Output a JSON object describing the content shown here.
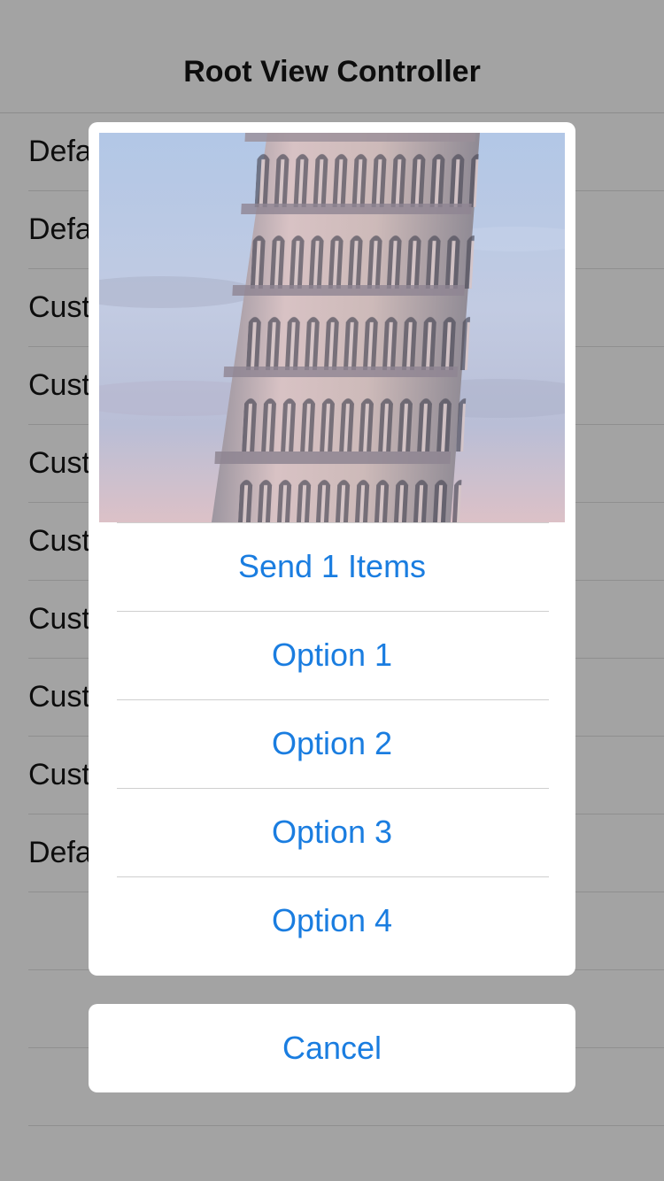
{
  "navbar": {
    "title": "Root View Controller"
  },
  "table": {
    "rows": [
      {
        "label": "Defa"
      },
      {
        "label": "Defa"
      },
      {
        "label": "Cust"
      },
      {
        "label": "Cust"
      },
      {
        "label": "Cust"
      },
      {
        "label": "Cust"
      },
      {
        "label": "Cust"
      },
      {
        "label": "Cust"
      },
      {
        "label": "Cust"
      },
      {
        "label": "Defa"
      },
      {
        "label": ""
      },
      {
        "label": ""
      },
      {
        "label": ""
      }
    ]
  },
  "action_sheet": {
    "photo_subject": "leaning-tower-photo",
    "items": [
      {
        "label": "Send 1 Items"
      },
      {
        "label": "Option 1"
      },
      {
        "label": "Option 2"
      },
      {
        "label": "Option 3"
      },
      {
        "label": "Option 4"
      }
    ],
    "cancel_label": "Cancel"
  },
  "colors": {
    "dim_background": "#a3a3a3",
    "action_blue": "#1a7de0",
    "sheet_background": "#ffffff"
  }
}
